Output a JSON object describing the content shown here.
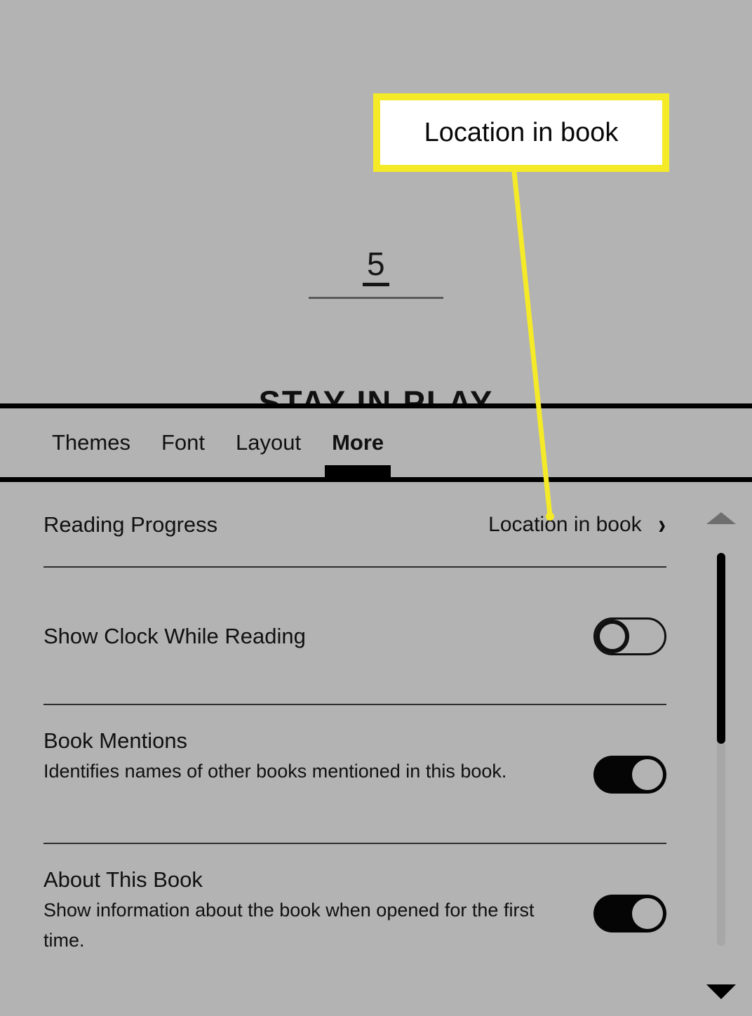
{
  "reader": {
    "page_number": "5",
    "chapter_heading": "STAY IN PLAY"
  },
  "annotation": {
    "label": "Location in book",
    "border_color": "#f5ea27",
    "line_color": "#f5ea27",
    "background_color": "#ffffff"
  },
  "tabs": [
    {
      "label": "Themes",
      "active": false
    },
    {
      "label": "Font",
      "active": false
    },
    {
      "label": "Layout",
      "active": false
    },
    {
      "label": "More",
      "active": true
    }
  ],
  "settings": [
    {
      "title": "Reading Progress",
      "description": "",
      "control": "value-chevron",
      "value": "Location in book",
      "chevron": "chevron-right-icon"
    },
    {
      "title": "Show Clock While Reading",
      "description": "",
      "control": "toggle",
      "toggle_state": "off"
    },
    {
      "title": "Book Mentions",
      "description": "Identifies names of other books mentioned in this book.",
      "control": "toggle",
      "toggle_state": "on"
    },
    {
      "title": "About This Book",
      "description": "Show information about the book when opened for the first time.",
      "control": "toggle",
      "toggle_state": "on"
    }
  ],
  "scrollbar": {
    "up_arrow": "triangle-up-icon",
    "down_arrow": "triangle-down-icon"
  }
}
